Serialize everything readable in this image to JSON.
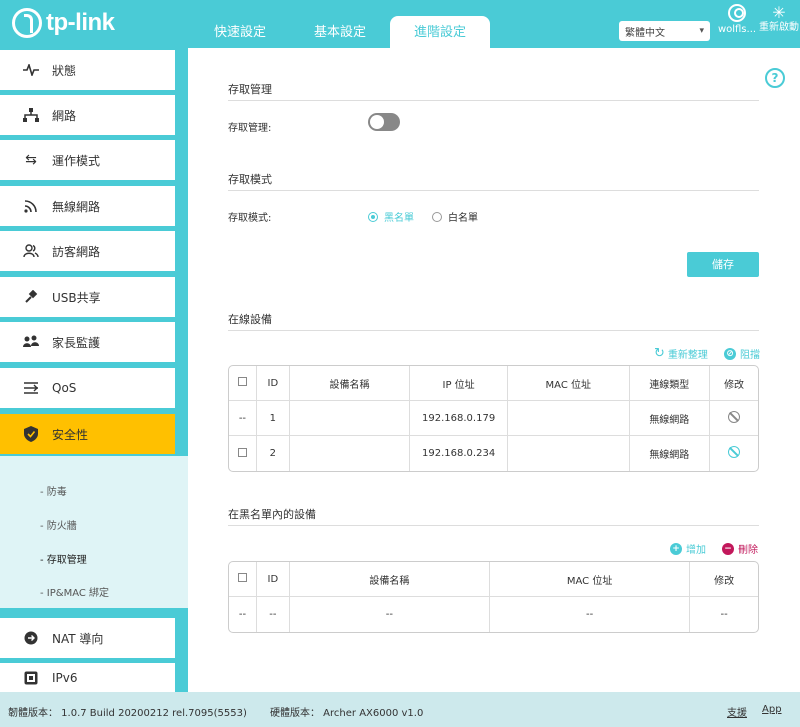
{
  "header": {
    "brand": "tp-link",
    "tabs": [
      "快速設定",
      "基本設定",
      "進階設定"
    ],
    "language": "繁體中文",
    "user": "wolfls...",
    "reboot": "重新啟動"
  },
  "sidebar": {
    "items": [
      {
        "label": "狀態",
        "icon": "pulse-icon"
      },
      {
        "label": "網路",
        "icon": "network-icon"
      },
      {
        "label": "運作模式",
        "icon": "mode-switch-icon"
      },
      {
        "label": "無線網路",
        "icon": "wifi-icon"
      },
      {
        "label": "訪客網路",
        "icon": "guest-users-icon"
      },
      {
        "label": "USB共享",
        "icon": "usb-icon"
      },
      {
        "label": "家長監護",
        "icon": "family-icon"
      },
      {
        "label": "QoS",
        "icon": "qos-icon"
      },
      {
        "label": "安全性",
        "icon": "shield-icon"
      },
      {
        "label": "NAT 導向",
        "icon": "nat-icon"
      },
      {
        "label": "IPv6",
        "icon": "ipv6-icon"
      }
    ],
    "subitems": [
      "- 防毒",
      "- 防火牆",
      "- 存取管理",
      "- IP&MAC 綁定"
    ]
  },
  "main": {
    "access_mgmt": {
      "title": "存取管理",
      "label": "存取管理:"
    },
    "access_mode": {
      "title": "存取模式",
      "label": "存取模式:",
      "options": [
        "黑名單",
        "白名單"
      ],
      "selected": "黑名單"
    },
    "save": "儲存",
    "online": {
      "title": "在線設備",
      "refresh": "重新整理",
      "block": "阻擋",
      "columns": [
        "ID",
        "設備名稱",
        "IP 位址",
        "MAC 位址",
        "連線類型",
        "修改"
      ],
      "rows": [
        {
          "check": "--",
          "id": "1",
          "name": "",
          "ip": "192.168.0.179",
          "mac": "",
          "type": "無線網路"
        },
        {
          "check": "",
          "id": "2",
          "name": "",
          "ip": "192.168.0.234",
          "mac": "",
          "type": "無線網路"
        }
      ]
    },
    "blacklist": {
      "title": "在黑名單內的設備",
      "add": "增加",
      "delete": "刪除",
      "columns": [
        "ID",
        "設備名稱",
        "MAC 位址",
        "修改"
      ],
      "rows": [
        [
          "--",
          "--",
          "--",
          "--",
          "--"
        ]
      ]
    }
  },
  "footer": {
    "firmware": "韌體版本： 1.0.7 Build 20200212 rel.7095(5553)",
    "hardware": "硬體版本： Archer AX6000 v1.0",
    "support": "支援",
    "app": "App"
  }
}
